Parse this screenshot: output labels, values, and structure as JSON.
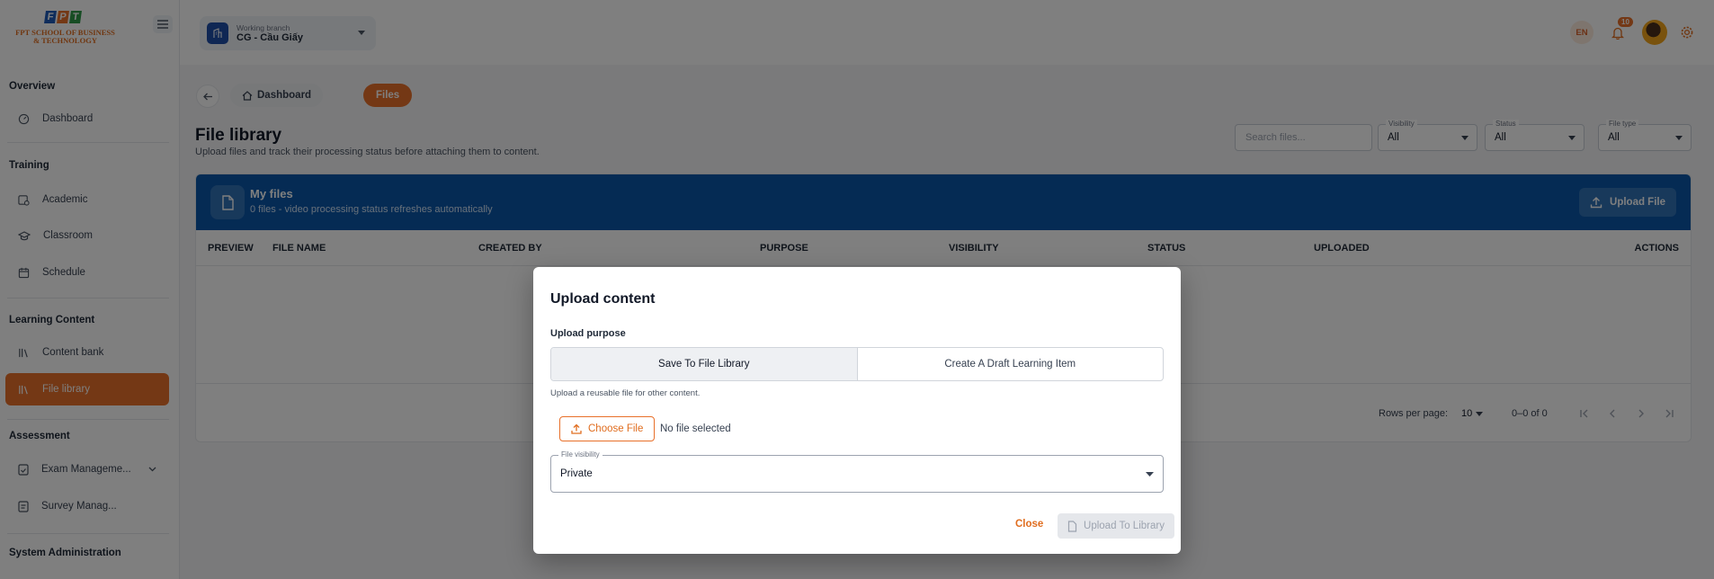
{
  "brand": {
    "logo_letters": [
      "F",
      "P",
      "T"
    ],
    "logo_colors": [
      "#1e5ab8",
      "#e8702a",
      "#2e9b48"
    ],
    "logo_line1": "FPT SCHOOL OF BUSINESS",
    "logo_line2": "& TECHNOLOGY"
  },
  "sidebar": {
    "sections": {
      "overview": "Overview",
      "training": "Training",
      "learning_content": "Learning Content",
      "assessment": "Assessment",
      "system_admin": "System Administration"
    },
    "items": {
      "dashboard": "Dashboard",
      "academic": "Academic",
      "classroom": "Classroom",
      "schedule": "Schedule",
      "content_bank": "Content bank",
      "file_library": "File library",
      "exam_management": "Exam Manageme...",
      "survey_management": "Survey Manag..."
    }
  },
  "topbar": {
    "branch_label": "Working branch",
    "branch_value": "CG - Cầu Giấy",
    "language": "EN",
    "notification_count": "10"
  },
  "breadcrumb": {
    "home": "Dashboard",
    "current": "Files"
  },
  "page": {
    "title": "File library",
    "subtitle": "Upload files and track their processing status before attaching them to content."
  },
  "filters": {
    "search_placeholder": "Search files...",
    "visibility_label": "Visibility",
    "visibility_value": "All",
    "status_label": "Status",
    "status_value": "All",
    "filetype_label": "File type",
    "filetype_value": "All"
  },
  "panel": {
    "title": "My files",
    "subtitle": "0 files - video processing status refreshes automatically",
    "upload_button": "Upload File"
  },
  "table": {
    "columns": {
      "preview": "PREVIEW",
      "file_name": "FILE NAME",
      "created_by": "CREATED BY",
      "purpose": "PURPOSE",
      "visibility": "VISIBILITY",
      "status": "STATUS",
      "uploaded": "UPLOADED",
      "actions": "ACTIONS"
    },
    "rows_per_page_label": "Rows per page:",
    "rows_per_page_value": "10",
    "range": "0–0 of 0"
  },
  "modal": {
    "title": "Upload content",
    "purpose_label": "Upload purpose",
    "option_library": "Save To File Library",
    "option_draft": "Create A Draft Learning Item",
    "help_text": "Upload a reusable file for other content.",
    "choose_file": "Choose File",
    "no_file": "No file selected",
    "visibility_label": "File visibility",
    "visibility_value": "Private",
    "close": "Close",
    "upload_to_library": "Upload To Library"
  },
  "colors": {
    "accent": "#e8702a",
    "panel_header": "#0a57a8",
    "overlay": "rgba(0,0,0,0.5)"
  }
}
